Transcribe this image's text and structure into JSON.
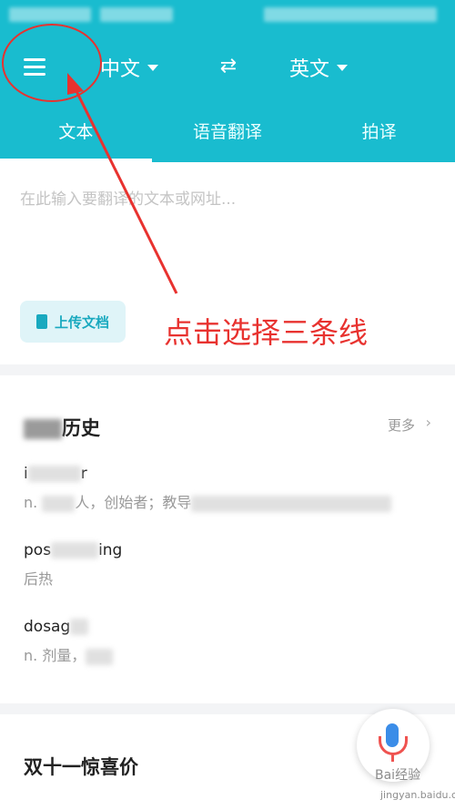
{
  "header": {
    "source_lang": "中文",
    "target_lang": "英文",
    "tabs": [
      {
        "label": "文本",
        "active": true
      },
      {
        "label": "语音翻译",
        "active": false
      },
      {
        "label": "拍译",
        "active": false
      }
    ]
  },
  "input": {
    "placeholder": "在此输入要翻译的文本或网址...",
    "upload_label": "上传文档"
  },
  "history": {
    "title_visible": "历史",
    "more_label": "更多",
    "items": [
      {
        "word_start": "i",
        "word_end": "r",
        "def_start": "n.",
        "def_mid": "人，创始者；教导"
      },
      {
        "word_start": "pos",
        "word_end": "ing",
        "def_start": "后热",
        "def_mid": ""
      },
      {
        "word_start": "dosag",
        "word_end": "",
        "def_start": "n. 剂量，",
        "def_mid": ""
      }
    ]
  },
  "promo": {
    "title": "双十一惊喜价"
  },
  "annotation": {
    "text": "点击选择三条线"
  },
  "watermark": {
    "line1": "Bai经验",
    "line2": "jingyan.baidu.com"
  },
  "colors": {
    "header_bg": "#19bccf",
    "annotation_red": "#e8322f",
    "accent_blue": "#3b8de8"
  }
}
